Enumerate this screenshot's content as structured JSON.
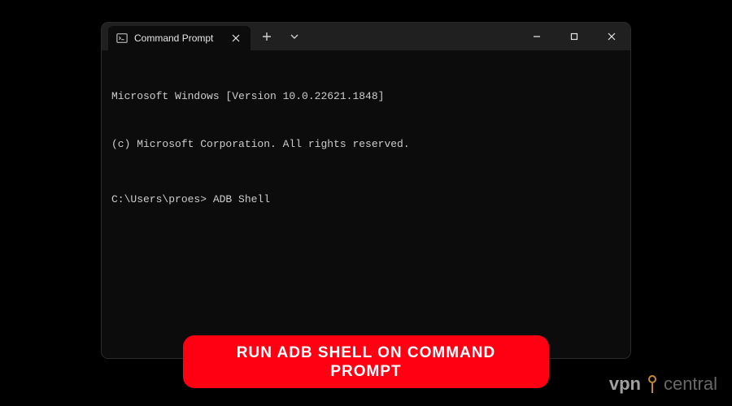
{
  "window": {
    "tab": {
      "title": "Command Prompt"
    }
  },
  "terminal": {
    "line1": "Microsoft Windows [Version 10.0.22621.1848]",
    "line2": "(c) Microsoft Corporation. All rights reserved.",
    "prompt": "C:\\Users\\proes> ",
    "command": "ADB Shell"
  },
  "caption": {
    "text": "RUN ADB SHELL ON COMMAND PROMPT"
  },
  "watermark": {
    "part1": "vpn",
    "part2": "central"
  }
}
